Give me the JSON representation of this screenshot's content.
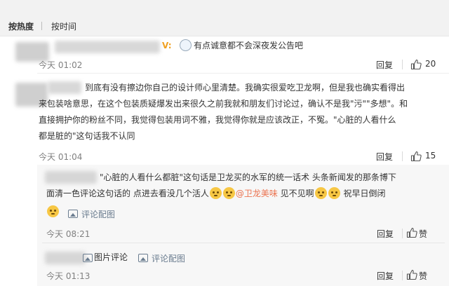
{
  "sort_bar": {
    "hot": "按热度",
    "time": "按时间"
  },
  "comments": [
    {
      "vip_badge": "V:",
      "text": "有点诚意都不会深夜发公告吧",
      "time": "今天 01:02",
      "reply_label": "回复",
      "likes": "20"
    },
    {
      "lines": [
        "到底有没有擦边你自己的设计师心里清楚。我确实很爱吃卫龙啊，但是我也确实看得出",
        "来包装啥意思，在这个包装质疑爆发出来很久之前我就和朋友们讨论过，确认不是我\"污\"\"多想\"。和",
        "直接拥护你的粉丝不同，我觉得包装用词不雅，我觉得你就是应该改正，不冤。\"心脏的人看什么",
        "都是脏的\"这句话我不认同"
      ],
      "time": "今天 01:04",
      "reply_label": "回复",
      "likes": "15"
    }
  ],
  "replies": [
    {
      "line1": "\"心脏的人看什么都脏\"这句话是卫龙买的水军的统一话术 头条新闻发的那条博下",
      "line2_pre": "面清一色评论这句话的 点进去看没几个活人",
      "mention": "@卫龙美味",
      "line2_mid": " 见不见啊",
      "line2_post": " 祝早日倒闭",
      "img_link": "评论配图",
      "time": "今天 08:21",
      "reply_label": "回复",
      "like_label": "赞"
    },
    {
      "img_text": "图片评论",
      "img_link": "评论配图",
      "time": "今天 01:13",
      "reply_label": "回复",
      "like_label": "赞"
    }
  ]
}
